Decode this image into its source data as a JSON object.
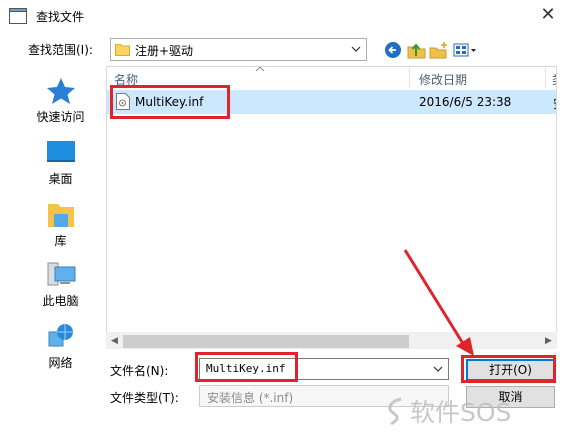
{
  "window": {
    "title": "查找文件"
  },
  "lookin": {
    "label": "查找范围(I):",
    "value": "注册+驱动"
  },
  "toolbar": {
    "back": "back-icon",
    "up": "up-folder-icon",
    "new_folder": "new-folder-icon",
    "views": "view-menu-icon"
  },
  "places": [
    {
      "label": "快速访问",
      "icon": "star-icon"
    },
    {
      "label": "桌面",
      "icon": "desktop-icon"
    },
    {
      "label": "库",
      "icon": "library-icon"
    },
    {
      "label": "此电脑",
      "icon": "computer-icon"
    },
    {
      "label": "网络",
      "icon": "network-icon"
    }
  ],
  "filelist": {
    "columns": {
      "name": "名称",
      "date": "修改日期",
      "more": "类"
    },
    "rows": [
      {
        "name": "MultiKey.inf",
        "date": "2016/6/5 23:38",
        "more": "安"
      }
    ]
  },
  "filename": {
    "label": "文件名(N):",
    "value": "MultiKey.inf"
  },
  "filetype": {
    "label": "文件类型(T):",
    "value": "安装信息 (*.inf)"
  },
  "buttons": {
    "open": "打开(O)",
    "cancel": "取消"
  },
  "watermark": {
    "text": "软件SOS"
  },
  "colors": {
    "highlight": "#e0242c",
    "selection": "#cce8ff",
    "accent": "#0078d7"
  }
}
